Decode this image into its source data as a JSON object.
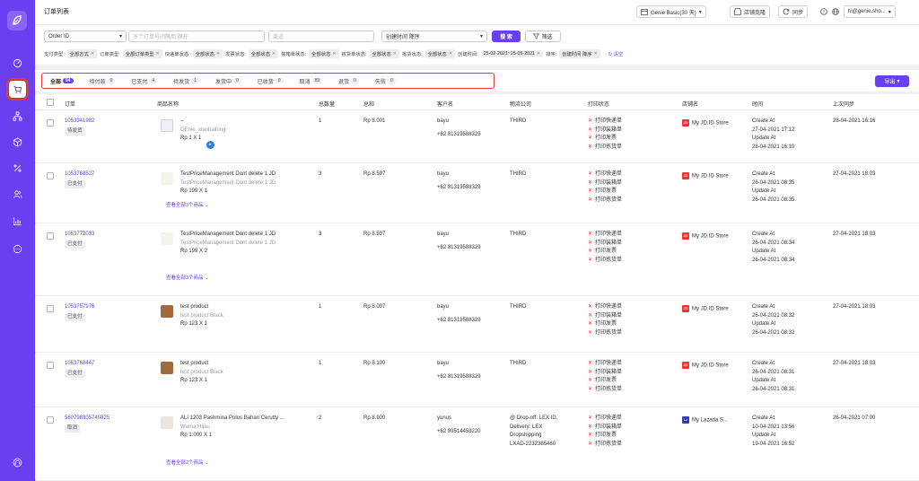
{
  "page_title": "订单列表",
  "topbar": {
    "plan": "Genie Basic(30 天)",
    "shop_clone": "店铺克隆",
    "sync": "同步",
    "account": "hi@genie.sho..."
  },
  "filters": {
    "order_id_select": "Order ID",
    "search_placeholder": "多个订单号间隔用,隔开",
    "channel_placeholder": "渠道",
    "sort_select": "创建时间 降序",
    "search_button": "搜 索",
    "filter_button": "筛选",
    "chips": [
      {
        "label": "支付类型:",
        "value": "全部方式"
      },
      {
        "label": "订单类型:",
        "value": "全部订单类型"
      },
      {
        "label": "快递单状态:",
        "value": "全部状态"
      },
      {
        "label": "发票状态:",
        "value": "全部状态"
      },
      {
        "label": "装箱单状态:",
        "value": "全部状态"
      },
      {
        "label": "拣货单状态:",
        "value": "全部状态"
      },
      {
        "label": "拣货状态:",
        "value": "全部状态"
      },
      {
        "label": "创建时间:",
        "value": "25-02-2021~25-05-2021"
      },
      {
        "label": "排序:",
        "value": "创建时间 降序"
      }
    ],
    "clear": "清空"
  },
  "tabs": [
    {
      "label": "全部",
      "count": "94",
      "active": true
    },
    {
      "label": "待付款",
      "count": "0"
    },
    {
      "label": "已支付",
      "count": "4"
    },
    {
      "label": "待发货",
      "count": "1"
    },
    {
      "label": "发货中",
      "count": "0"
    },
    {
      "label": "已收货",
      "count": "0"
    },
    {
      "label": "取消",
      "count": "89"
    },
    {
      "label": "退货",
      "count": "0"
    },
    {
      "label": "失败",
      "count": "0"
    }
  ],
  "export_button": "导出",
  "columns": {
    "order": "订单",
    "product": "商品名称",
    "qty": "总数量",
    "total": "总和",
    "customer": "客户名",
    "logistics": "物流公司",
    "print": "打印状态",
    "store": "店铺名",
    "time": "时间",
    "last_sync": "上次同步"
  },
  "print_labels": [
    "打印快递单",
    "打印装箱单",
    "打印发票",
    "打印拣货单"
  ],
  "orders": [
    {
      "id": "1053941982",
      "status": "待发货",
      "product_name": "–",
      "product_variant": "GEnie_xiaobailong",
      "product_price": "Rp 1 X 1",
      "more": "",
      "qty": "1",
      "total": "Rp 8.001",
      "customer": "bayu",
      "phone": "+62 81319588329",
      "logistics": [
        "THIRD"
      ],
      "store": "My JD.ID Store",
      "store_color": "#e53935",
      "store_icon": "JD",
      "created": "27-04-2021 17:12",
      "updated": "28-04-2021 16:10",
      "last_sync": "28-04-2021 16:16"
    },
    {
      "id": "1053768527",
      "status": "已支付",
      "product_name": "TestPriceManagement Dont delete 1 JD",
      "product_variant": "TestPriceManagement Dont delete 1 JD",
      "product_price": "Rp 199 X 1",
      "more": "查看全部3个商品",
      "qty": "3",
      "total": "Rp 8.597",
      "customer": "bayu",
      "phone": "+62 81319588329",
      "logistics": [
        "THIRD"
      ],
      "store": "My JD.ID Store",
      "store_color": "#e53935",
      "store_icon": "JD",
      "created": "26-04-2021 08:35",
      "updated": "26-04-2021 08:35",
      "last_sync": "27-04-2021 18:03"
    },
    {
      "id": "1053772033",
      "status": "已支付",
      "product_name": "TestPriceManagement Dont delete 1 JD",
      "product_variant": "TestPriceManagement Dont delete 1 JD",
      "product_price": "Rp 199 X 2",
      "more": "查看全部3个商品",
      "qty": "3",
      "total": "Rp 8.597",
      "customer": "bayu",
      "phone": "+62 81319588329",
      "logistics": [
        "THIRD"
      ],
      "store": "My JD.ID Store",
      "store_color": "#e53935",
      "store_icon": "JD",
      "created": "26-04-2021 08:34",
      "updated": "26-04-2021 08:34",
      "last_sync": "27-04-2021 18:03"
    },
    {
      "id": "1053757976",
      "status": "已支付",
      "product_name": "test product",
      "product_variant": "test product Black",
      "product_price": "Rp 123 X 1",
      "more": "",
      "qty": "1",
      "total": "Rp 8.097",
      "customer": "bayu",
      "phone": "+62 81319588329",
      "logistics": [
        "THIRD"
      ],
      "store": "My JD.ID Store",
      "store_color": "#e53935",
      "store_icon": "JD",
      "created": "26-04-2021 08:32",
      "updated": "26-04-2021 08:32",
      "last_sync": "27-04-2021 18:03"
    },
    {
      "id": "1053768447",
      "status": "已支付",
      "product_name": "test product",
      "product_variant": "test product Black",
      "product_price": "Rp 123 X 1",
      "more": "",
      "qty": "1",
      "total": "Rp 8.100",
      "customer": "bayu",
      "phone": "+62 81319588329",
      "logistics": [
        "THIRD"
      ],
      "store": "My JD.ID Store",
      "store_color": "#e53935",
      "store_icon": "JD",
      "created": "26-04-2021 08:31",
      "updated": "26-04-2021 08:31",
      "last_sync": "27-04-2021 18:03"
    },
    {
      "id": "580798305740825",
      "status": "取消",
      "product_name": "ALI 1203 Pashmina Polos Bahan Cerutty ...",
      "product_variant": "Warna:Hijau",
      "product_price": "Rp 1.000 X 1",
      "more": "查看全部2个商品",
      "qty": "2",
      "total": "Rp 8.900",
      "customer": "yunus",
      "phone": "+62 89514458220",
      "logistics": [
        "@ Drop-off: LEX ID,",
        "Delivery: LEX",
        "Dropshipping",
        "LXAD-2232385460"
      ],
      "store": "My Lazada S...",
      "store_color": "#2d3db4",
      "store_icon": "Lz",
      "created": "10-04-2021 13:56",
      "updated": "19-04-2021 16:52",
      "last_sync": "26-04-2021 07:00"
    }
  ],
  "time_labels": {
    "created": "Create At",
    "updated": "Update At"
  }
}
